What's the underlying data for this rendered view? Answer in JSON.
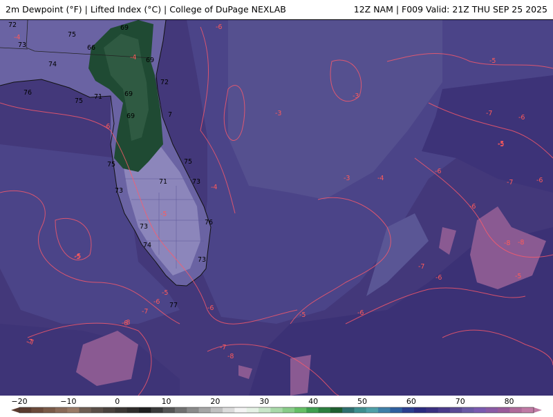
{
  "header": {
    "left": "2m Dewpoint (°F) | Lifted Index (°C) | College of DuPage NEXLAB",
    "right": "12Z NAM | F009 Valid: 21Z THU SEP 25 2025"
  },
  "colorbar": {
    "ticks": [
      "−20",
      "−10",
      "0",
      "10",
      "20",
      "30",
      "40",
      "50",
      "60",
      "70",
      "80"
    ],
    "segment_colors": [
      "#5b3b2e",
      "#6b4a3a",
      "#7a5a48",
      "#8a6a58",
      "#9a7a66",
      "#6e5d52",
      "#5a4e47",
      "#4a423d",
      "#3c3734",
      "#2f2c2a",
      "#1f1f1f",
      "#3a3a3a",
      "#555555",
      "#707070",
      "#8a8a8a",
      "#a5a5a5",
      "#c0c0c0",
      "#dcdcdc",
      "#f4f4f4",
      "#e6f2e6",
      "#c9e6c9",
      "#a9d9a9",
      "#89cc89",
      "#66bf66",
      "#3f9f4f",
      "#2c7f3f",
      "#1f5f30",
      "#2f6f6f",
      "#3f8f8f",
      "#4fa0a8",
      "#3f7fa8",
      "#2f5f9f",
      "#2a3f8f",
      "#2a2a7f",
      "#3a2f80",
      "#4a3a8a",
      "#5a4a95",
      "#6a5aa5",
      "#7a5ab0",
      "#8a5aa5",
      "#9a5a9a",
      "#b06a9a",
      "#c07aa5"
    ],
    "tick_values": [
      -20,
      -10,
      0,
      10,
      20,
      30,
      40,
      50,
      60,
      70,
      80
    ]
  },
  "map": {
    "dewpoint_labels": [
      "72",
      "71",
      "75",
      "73",
      "74",
      "76",
      "69",
      "66",
      "69",
      "72",
      "71",
      "69",
      "7",
      "75",
      "69",
      "75",
      "73",
      "71",
      "73",
      "76",
      "74",
      "73",
      "73",
      "77",
      "75"
    ],
    "lifted_index_labels": [
      "-4",
      "-6",
      "-5",
      "-3",
      "-4",
      "-3",
      "-6",
      "-4",
      "-5",
      "-6",
      "-7",
      "-6",
      "-5",
      "-5",
      "-6",
      "-7",
      "-6",
      "-7",
      "-8",
      "-5",
      "-6",
      "-5",
      "-6",
      "-7",
      "-8",
      "-8",
      "-7",
      "-6",
      "-5",
      "-6",
      "-5",
      "-7",
      "-8",
      "-8",
      "-7",
      "-5",
      "-4",
      "-3"
    ]
  }
}
